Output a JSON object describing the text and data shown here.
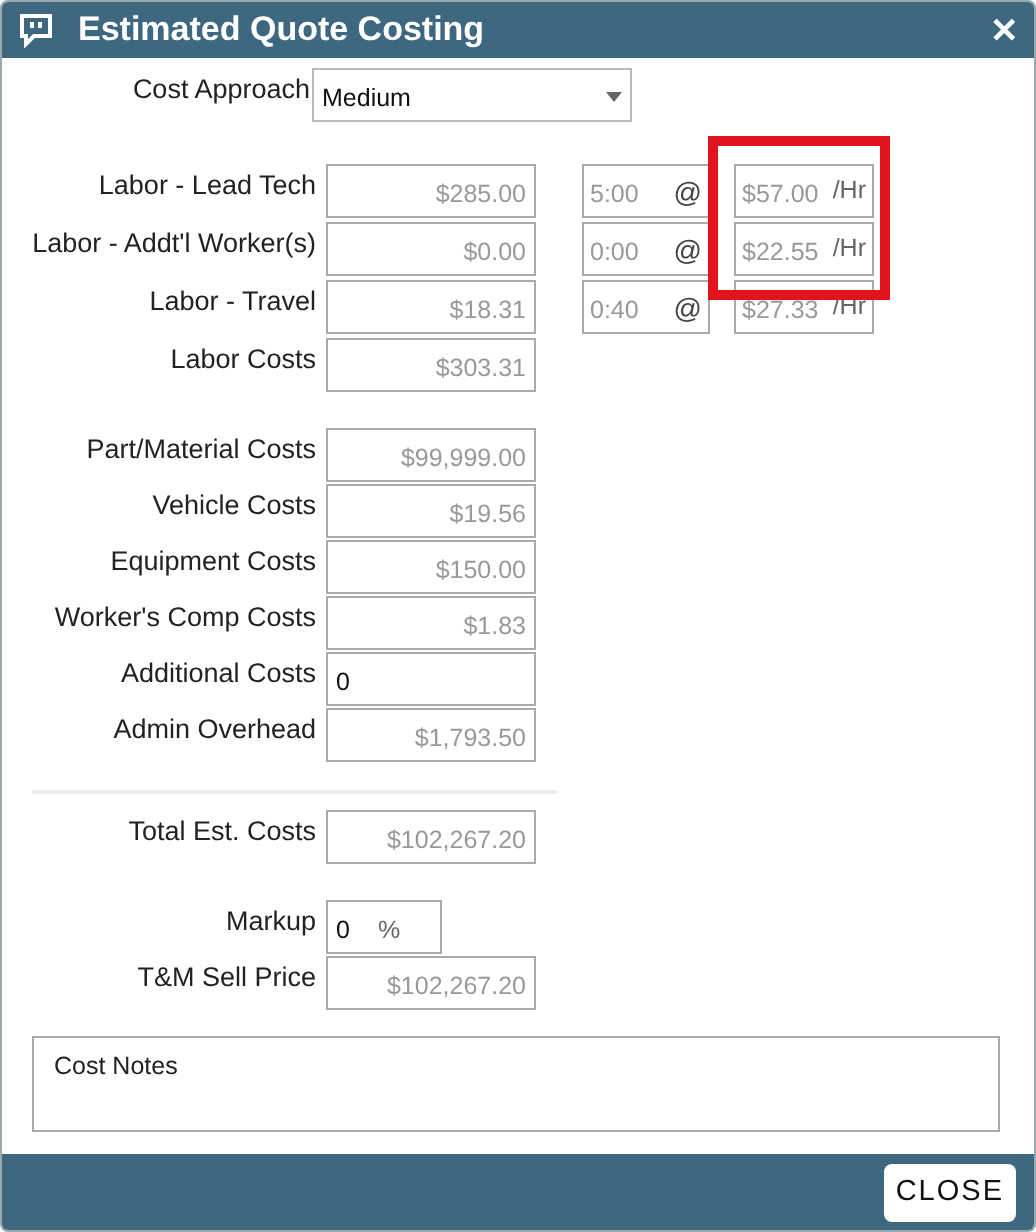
{
  "window": {
    "title": "Estimated Quote Costing",
    "close_glyph": "✕"
  },
  "cost_approach": {
    "label": "Cost Approach",
    "value": "Medium"
  },
  "labor_rows": [
    {
      "label": "Labor - Lead Tech",
      "amount": "$285.00",
      "hours": "5:00",
      "at": "@",
      "rate": "$57.00",
      "unit": "/Hr",
      "highlighted": true
    },
    {
      "label": "Labor - Addt'l Worker(s)",
      "amount": "$0.00",
      "hours": "0:00",
      "at": "@",
      "rate": "$22.55",
      "unit": "/Hr",
      "highlighted": true
    },
    {
      "label": "Labor - Travel",
      "amount": "$18.31",
      "hours": "0:40",
      "at": "@",
      "rate": "$27.33",
      "unit": "/Hr",
      "highlighted": false
    }
  ],
  "labor_total": {
    "label": "Labor Costs",
    "value": "$303.31",
    "kind": "readonly"
  },
  "cost_rows": [
    {
      "label": "Part/Material Costs",
      "value": "$99,999.00",
      "kind": "readonly"
    },
    {
      "label": "Vehicle Costs",
      "value": "$19.56",
      "kind": "readonly"
    },
    {
      "label": "Equipment Costs",
      "value": "$150.00",
      "kind": "readonly"
    },
    {
      "label": "Worker's Comp Costs",
      "value": "$1.83",
      "kind": "readonly"
    },
    {
      "label": "Additional Costs",
      "value": "0",
      "kind": "editable"
    },
    {
      "label": "Admin Overhead",
      "value": "$1,793.50",
      "kind": "readonly"
    }
  ],
  "total": {
    "label": "Total Est. Costs",
    "value": "$102,267.20",
    "kind": "readonly"
  },
  "markup": {
    "label": "Markup",
    "value": "0",
    "unit": "%"
  },
  "sell_price": {
    "label": "T&M Sell Price",
    "value": "$102,267.20",
    "kind": "readonly"
  },
  "notes": {
    "placeholder": "Cost Notes"
  },
  "buttons": [
    {
      "label": "CLOSE"
    }
  ]
}
